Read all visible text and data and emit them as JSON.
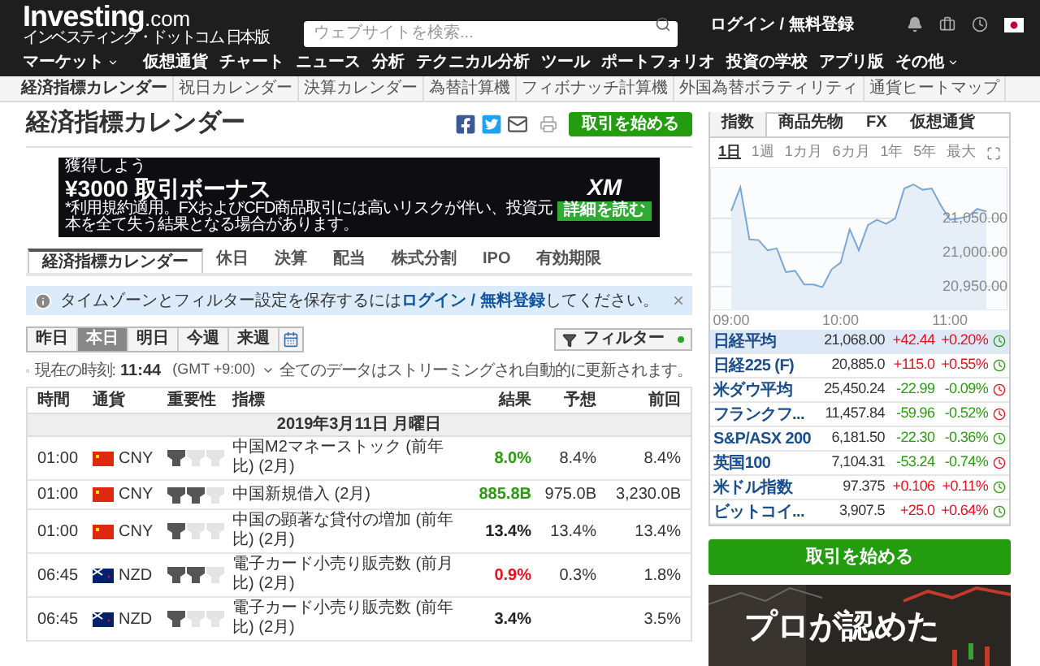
{
  "header": {
    "logo": "Investing",
    "logo_suffix": ".com",
    "tagline": "インベスティング・ドットコム 日本版",
    "search": {
      "placeholder": "ウェブサイトを検索..."
    },
    "login": "ログイン / 無料登録"
  },
  "nav": [
    {
      "label": "マーケット",
      "has_menu": true
    },
    {
      "label": "仮想通貨",
      "has_menu": false
    },
    {
      "label": "チャート",
      "has_menu": false
    },
    {
      "label": "ニュース",
      "has_menu": false
    },
    {
      "label": "分析",
      "has_menu": false
    },
    {
      "label": "テクニカル分析",
      "has_menu": false
    },
    {
      "label": "ツール",
      "has_menu": false
    },
    {
      "label": "ポートフォリオ",
      "has_menu": false
    },
    {
      "label": "投資の学校",
      "has_menu": false
    },
    {
      "label": "アプリ版",
      "has_menu": false
    },
    {
      "label": "その他",
      "has_menu": true
    }
  ],
  "subnav": [
    {
      "label": "経済指標カレンダー",
      "selected": true
    },
    {
      "label": "祝日カレンダー",
      "selected": false
    },
    {
      "label": "決算カレンダー",
      "selected": false
    },
    {
      "label": "為替計算機",
      "selected": false
    },
    {
      "label": "フィボナッチ計算機",
      "selected": false
    },
    {
      "label": "外国為替ボラティリティ",
      "selected": false
    },
    {
      "label": "通貨ヒートマップ",
      "selected": false
    }
  ],
  "page_title": "経済指標カレンダー",
  "trade_button": "取引を始める",
  "ad": {
    "headline": "獲得しよう",
    "offer": "¥3000 取引ボーナス",
    "disclaimer": "*利用規約適用。FXおよびCFD商品取引には高いリスクが伴い、投資元本を全て失う結果となる場合があります。",
    "brand": "XM",
    "cta": "詳細を読む"
  },
  "tabs": [
    {
      "label": "経済指標カレンダー",
      "selected": true
    },
    {
      "label": "休日",
      "selected": false
    },
    {
      "label": "決算",
      "selected": false
    },
    {
      "label": "配当",
      "selected": false
    },
    {
      "label": "株式分割",
      "selected": false
    },
    {
      "label": "IPO",
      "selected": false
    },
    {
      "label": "有効期限",
      "selected": false
    }
  ],
  "notice": {
    "text": "タイムゾーンとフィルター設定を保存するには",
    "link": "ログイン / 無料登録",
    "text_after": "してください。",
    "close": "×"
  },
  "days": [
    {
      "label": "昨日",
      "selected": false
    },
    {
      "label": "本日",
      "selected": true
    },
    {
      "label": "明日",
      "selected": false
    },
    {
      "label": "今週",
      "selected": false
    },
    {
      "label": "来週",
      "selected": false
    }
  ],
  "filter": {
    "label": "フィルター",
    "active": true
  },
  "clock": {
    "label": "現在の時刻:",
    "time": "11:44",
    "timezone": "(GMT +9:00)"
  },
  "stream_note": "全てのデータはストリーミングされ自動的に更新されます。",
  "table": {
    "columns": [
      "時間",
      "通貨",
      "重要性",
      "指標",
      "結果",
      "予想",
      "前回"
    ],
    "date": "2019年3月11日 月曜日",
    "rows": [
      {
        "time": "01:00",
        "kind": "cn",
        "currency": "CNY",
        "stars": 1,
        "indicator": "中国M2マネーストック (前年比) (2月)",
        "actual": "8.0%",
        "color": "#2a9d0f",
        "forecast": "8.4%",
        "previous": "8.4%"
      },
      {
        "time": "01:00",
        "kind": "cn",
        "currency": "CNY",
        "stars": 2,
        "indicator": "中国新規借入 (2月)",
        "actual": "885.8B",
        "color": "#2a9d0f",
        "forecast": "975.0B",
        "previous": "3,230.0B"
      },
      {
        "time": "01:00",
        "kind": "cn",
        "currency": "CNY",
        "stars": 1,
        "indicator": "中国の顕著な貸付の増加 (前年比) (2月)",
        "actual": "13.4%",
        "color": "#222222",
        "forecast": "13.4%",
        "previous": "13.4%"
      },
      {
        "time": "06:45",
        "kind": "nz",
        "currency": "NZD",
        "stars": 2,
        "indicator": "電子カード小売り販売数 (前月比) (2月)",
        "actual": "0.9%",
        "color": "#e8101d",
        "forecast": "0.3%",
        "previous": "1.8%"
      },
      {
        "time": "06:45",
        "kind": "nz",
        "currency": "NZD",
        "stars": 1,
        "indicator": "電子カード小売り販売数 (前年比) (2月)",
        "actual": "3.4%",
        "color": "#222222",
        "previous": "3.5%"
      }
    ]
  },
  "sidebar": {
    "tabs": [
      {
        "label": "指数",
        "selected": true
      },
      {
        "label": "商品先物",
        "selected": false
      },
      {
        "label": "FX",
        "selected": false
      },
      {
        "label": "仮想通貨",
        "selected": false
      }
    ],
    "periods": [
      {
        "label": "1日",
        "selected": true
      },
      {
        "label": "1週",
        "selected": false
      },
      {
        "label": "1カ月",
        "selected": false
      },
      {
        "label": "6カ月",
        "selected": false
      },
      {
        "label": "1年",
        "selected": false
      },
      {
        "label": "5年",
        "selected": false
      },
      {
        "label": "最大",
        "selected": false
      }
    ],
    "chart_data": {
      "type": "area",
      "categories": [
        "09:00",
        null,
        null,
        null,
        null,
        null,
        null,
        null,
        null,
        null,
        null,
        null,
        "10:00",
        null,
        null,
        null,
        null,
        null,
        null,
        null,
        null,
        null,
        null,
        null,
        "11:00",
        null,
        null,
        null,
        null
      ],
      "series": [
        {
          "color": "#7ba7d7",
          "values": [
            21061,
            21096,
            21019,
            21018,
            21003,
            21006,
            20971,
            20973,
            20953,
            20953,
            20949,
            20975,
            20985,
            21034,
            21003,
            21040,
            21048,
            21042,
            21050,
            21094,
            21100,
            21092,
            21094,
            21069,
            21048,
            21050,
            21053,
            21064,
            21060
          ]
        }
      ],
      "grid": true,
      "ylim": [
        20915,
        21125
      ],
      "yticks": [
        {
          "value": 21050,
          "label": "21,050.00"
        },
        {
          "value": 21000,
          "label": "21,000.00"
        },
        {
          "value": 20950,
          "label": "20,950.00"
        }
      ]
    },
    "markets": [
      {
        "name": "日経平均",
        "price": "21,068.00",
        "change": "+42.44",
        "pct": "+0.20%",
        "up": true,
        "open": true,
        "selected": true
      },
      {
        "name": "日経225 (F)",
        "price": "20,885.0",
        "change": "+115.0",
        "pct": "+0.55%",
        "up": true,
        "open": true,
        "selected": false
      },
      {
        "name": "米ダウ平均",
        "price": "25,450.24",
        "change": "-22.99",
        "pct": "-0.09%",
        "up": false,
        "open": false,
        "selected": false
      },
      {
        "name": "フランクフ...",
        "price": "11,457.84",
        "change": "-59.96",
        "pct": "-0.52%",
        "up": false,
        "open": false,
        "selected": false
      },
      {
        "name": "S&P/ASX 200",
        "price": "6,181.50",
        "change": "-22.30",
        "pct": "-0.36%",
        "up": false,
        "open": true,
        "selected": false
      },
      {
        "name": "英国100",
        "price": "7,104.31",
        "change": "-53.24",
        "pct": "-0.74%",
        "up": false,
        "open": false,
        "selected": false
      },
      {
        "name": "米ドル指数",
        "price": "97.375",
        "change": "+0.106",
        "pct": "+0.11%",
        "up": true,
        "open": true,
        "selected": false
      },
      {
        "name": "ビットコイ...",
        "price": "3,907.5",
        "change": "+25.0",
        "pct": "+0.64%",
        "up": true,
        "open": true,
        "selected": false
      }
    ],
    "trade_button": "取引を始める",
    "promo": "プロが認めた"
  }
}
